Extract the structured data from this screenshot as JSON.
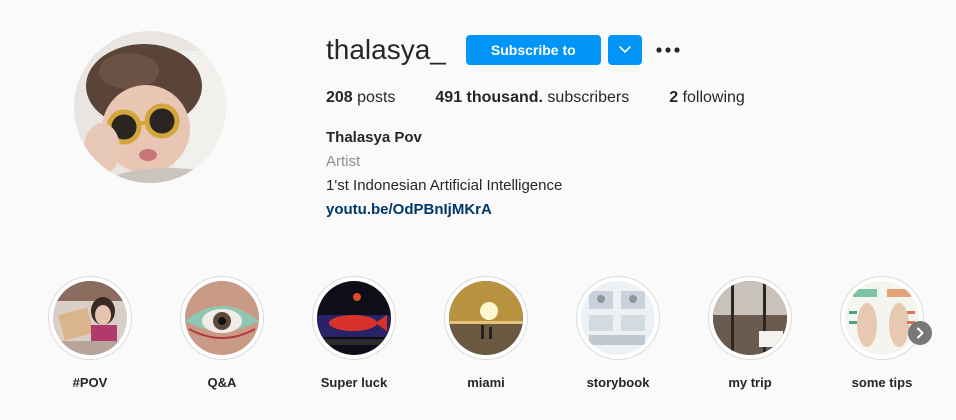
{
  "profile": {
    "username": "thalasya_",
    "subscribe_label": "Subscribe to",
    "dropdown_icon": "chevron-down-icon",
    "more_icon": "more-options-icon",
    "accent_color": "#0095f6"
  },
  "stats": {
    "posts_count": "208",
    "posts_label": " posts",
    "subscribers_count": "491 thousand.",
    "subscribers_label": " subscribers",
    "following_count": "2",
    "following_label": " following"
  },
  "bio": {
    "name": "Thalasya Pov",
    "category": "Artist",
    "description": "1'st Indonesian Artificial Intelligence",
    "link": "youtu.be/OdPBnIjMKrA"
  },
  "highlights": [
    {
      "label": "#POV"
    },
    {
      "label": "Q&A"
    },
    {
      "label": "Super luck"
    },
    {
      "label": "miami"
    },
    {
      "label": "storybook"
    },
    {
      "label": "my trip"
    },
    {
      "label": "some tips"
    }
  ],
  "next_icon": "chevron-right-icon"
}
